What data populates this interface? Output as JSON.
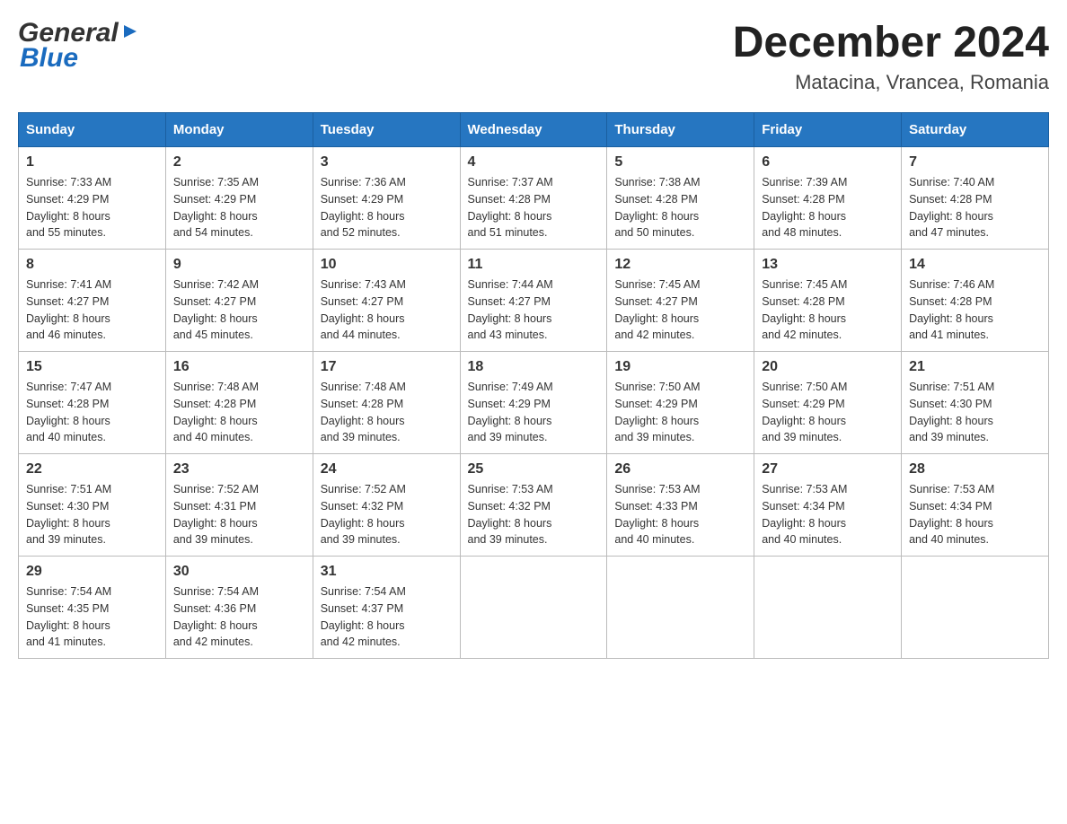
{
  "logo": {
    "general": "General",
    "blue": "Blue"
  },
  "title": "December 2024",
  "subtitle": "Matacina, Vrancea, Romania",
  "weekdays": [
    "Sunday",
    "Monday",
    "Tuesday",
    "Wednesday",
    "Thursday",
    "Friday",
    "Saturday"
  ],
  "weeks": [
    [
      {
        "day": "1",
        "sunrise": "Sunrise: 7:33 AM",
        "sunset": "Sunset: 4:29 PM",
        "daylight": "Daylight: 8 hours",
        "minutes": "and 55 minutes."
      },
      {
        "day": "2",
        "sunrise": "Sunrise: 7:35 AM",
        "sunset": "Sunset: 4:29 PM",
        "daylight": "Daylight: 8 hours",
        "minutes": "and 54 minutes."
      },
      {
        "day": "3",
        "sunrise": "Sunrise: 7:36 AM",
        "sunset": "Sunset: 4:29 PM",
        "daylight": "Daylight: 8 hours",
        "minutes": "and 52 minutes."
      },
      {
        "day": "4",
        "sunrise": "Sunrise: 7:37 AM",
        "sunset": "Sunset: 4:28 PM",
        "daylight": "Daylight: 8 hours",
        "minutes": "and 51 minutes."
      },
      {
        "day": "5",
        "sunrise": "Sunrise: 7:38 AM",
        "sunset": "Sunset: 4:28 PM",
        "daylight": "Daylight: 8 hours",
        "minutes": "and 50 minutes."
      },
      {
        "day": "6",
        "sunrise": "Sunrise: 7:39 AM",
        "sunset": "Sunset: 4:28 PM",
        "daylight": "Daylight: 8 hours",
        "minutes": "and 48 minutes."
      },
      {
        "day": "7",
        "sunrise": "Sunrise: 7:40 AM",
        "sunset": "Sunset: 4:28 PM",
        "daylight": "Daylight: 8 hours",
        "minutes": "and 47 minutes."
      }
    ],
    [
      {
        "day": "8",
        "sunrise": "Sunrise: 7:41 AM",
        "sunset": "Sunset: 4:27 PM",
        "daylight": "Daylight: 8 hours",
        "minutes": "and 46 minutes."
      },
      {
        "day": "9",
        "sunrise": "Sunrise: 7:42 AM",
        "sunset": "Sunset: 4:27 PM",
        "daylight": "Daylight: 8 hours",
        "minutes": "and 45 minutes."
      },
      {
        "day": "10",
        "sunrise": "Sunrise: 7:43 AM",
        "sunset": "Sunset: 4:27 PM",
        "daylight": "Daylight: 8 hours",
        "minutes": "and 44 minutes."
      },
      {
        "day": "11",
        "sunrise": "Sunrise: 7:44 AM",
        "sunset": "Sunset: 4:27 PM",
        "daylight": "Daylight: 8 hours",
        "minutes": "and 43 minutes."
      },
      {
        "day": "12",
        "sunrise": "Sunrise: 7:45 AM",
        "sunset": "Sunset: 4:27 PM",
        "daylight": "Daylight: 8 hours",
        "minutes": "and 42 minutes."
      },
      {
        "day": "13",
        "sunrise": "Sunrise: 7:45 AM",
        "sunset": "Sunset: 4:28 PM",
        "daylight": "Daylight: 8 hours",
        "minutes": "and 42 minutes."
      },
      {
        "day": "14",
        "sunrise": "Sunrise: 7:46 AM",
        "sunset": "Sunset: 4:28 PM",
        "daylight": "Daylight: 8 hours",
        "minutes": "and 41 minutes."
      }
    ],
    [
      {
        "day": "15",
        "sunrise": "Sunrise: 7:47 AM",
        "sunset": "Sunset: 4:28 PM",
        "daylight": "Daylight: 8 hours",
        "minutes": "and 40 minutes."
      },
      {
        "day": "16",
        "sunrise": "Sunrise: 7:48 AM",
        "sunset": "Sunset: 4:28 PM",
        "daylight": "Daylight: 8 hours",
        "minutes": "and 40 minutes."
      },
      {
        "day": "17",
        "sunrise": "Sunrise: 7:48 AM",
        "sunset": "Sunset: 4:28 PM",
        "daylight": "Daylight: 8 hours",
        "minutes": "and 39 minutes."
      },
      {
        "day": "18",
        "sunrise": "Sunrise: 7:49 AM",
        "sunset": "Sunset: 4:29 PM",
        "daylight": "Daylight: 8 hours",
        "minutes": "and 39 minutes."
      },
      {
        "day": "19",
        "sunrise": "Sunrise: 7:50 AM",
        "sunset": "Sunset: 4:29 PM",
        "daylight": "Daylight: 8 hours",
        "minutes": "and 39 minutes."
      },
      {
        "day": "20",
        "sunrise": "Sunrise: 7:50 AM",
        "sunset": "Sunset: 4:29 PM",
        "daylight": "Daylight: 8 hours",
        "minutes": "and 39 minutes."
      },
      {
        "day": "21",
        "sunrise": "Sunrise: 7:51 AM",
        "sunset": "Sunset: 4:30 PM",
        "daylight": "Daylight: 8 hours",
        "minutes": "and 39 minutes."
      }
    ],
    [
      {
        "day": "22",
        "sunrise": "Sunrise: 7:51 AM",
        "sunset": "Sunset: 4:30 PM",
        "daylight": "Daylight: 8 hours",
        "minutes": "and 39 minutes."
      },
      {
        "day": "23",
        "sunrise": "Sunrise: 7:52 AM",
        "sunset": "Sunset: 4:31 PM",
        "daylight": "Daylight: 8 hours",
        "minutes": "and 39 minutes."
      },
      {
        "day": "24",
        "sunrise": "Sunrise: 7:52 AM",
        "sunset": "Sunset: 4:32 PM",
        "daylight": "Daylight: 8 hours",
        "minutes": "and 39 minutes."
      },
      {
        "day": "25",
        "sunrise": "Sunrise: 7:53 AM",
        "sunset": "Sunset: 4:32 PM",
        "daylight": "Daylight: 8 hours",
        "minutes": "and 39 minutes."
      },
      {
        "day": "26",
        "sunrise": "Sunrise: 7:53 AM",
        "sunset": "Sunset: 4:33 PM",
        "daylight": "Daylight: 8 hours",
        "minutes": "and 40 minutes."
      },
      {
        "day": "27",
        "sunrise": "Sunrise: 7:53 AM",
        "sunset": "Sunset: 4:34 PM",
        "daylight": "Daylight: 8 hours",
        "minutes": "and 40 minutes."
      },
      {
        "day": "28",
        "sunrise": "Sunrise: 7:53 AM",
        "sunset": "Sunset: 4:34 PM",
        "daylight": "Daylight: 8 hours",
        "minutes": "and 40 minutes."
      }
    ],
    [
      {
        "day": "29",
        "sunrise": "Sunrise: 7:54 AM",
        "sunset": "Sunset: 4:35 PM",
        "daylight": "Daylight: 8 hours",
        "minutes": "and 41 minutes."
      },
      {
        "day": "30",
        "sunrise": "Sunrise: 7:54 AM",
        "sunset": "Sunset: 4:36 PM",
        "daylight": "Daylight: 8 hours",
        "minutes": "and 42 minutes."
      },
      {
        "day": "31",
        "sunrise": "Sunrise: 7:54 AM",
        "sunset": "Sunset: 4:37 PM",
        "daylight": "Daylight: 8 hours",
        "minutes": "and 42 minutes."
      },
      null,
      null,
      null,
      null
    ]
  ]
}
